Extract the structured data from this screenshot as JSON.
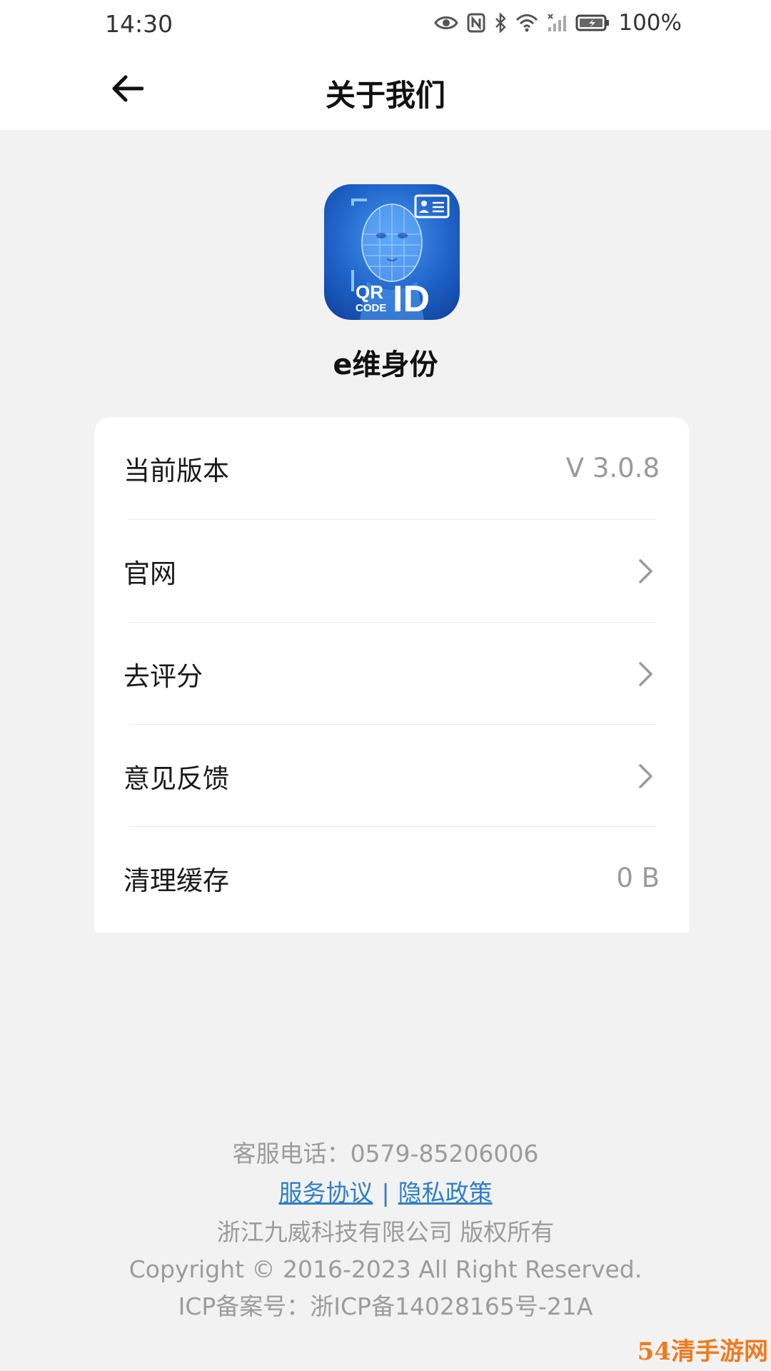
{
  "status_bar": {
    "time": "14:30",
    "battery": "100%",
    "icons": [
      "eye-icon",
      "nfc-icon",
      "bluetooth-icon",
      "wifi-icon",
      "signal-icon",
      "battery-icon"
    ]
  },
  "header": {
    "title": "关于我们",
    "back_icon": "arrow-left-icon"
  },
  "app": {
    "name": "e维身份",
    "logo_text_qr": "QR",
    "logo_text_code": "CODE",
    "logo_text_id": "ID"
  },
  "settings": {
    "rows": [
      {
        "label": "当前版本",
        "value": "V 3.0.8",
        "type": "value"
      },
      {
        "label": "官网",
        "type": "link"
      },
      {
        "label": "去评分",
        "type": "link"
      },
      {
        "label": "意见反馈",
        "type": "link"
      },
      {
        "label": "清理缓存",
        "value": "0 B",
        "type": "value"
      }
    ]
  },
  "footer": {
    "phone": "客服电话：0579-85206006",
    "service_agreement": "服务协议",
    "separator": "|",
    "privacy_policy": "隐私政策",
    "company": "浙江九威科技有限公司 版权所有",
    "copyright": "Copyright © 2016-2023 All Right Reserved.",
    "icp": "ICP备案号：浙ICP备14028165号-21A"
  },
  "watermark": "54清手游网",
  "colors": {
    "link": "#2f7fc7",
    "background": "#f2f2f2",
    "logo_blue": "#1f63c9"
  }
}
